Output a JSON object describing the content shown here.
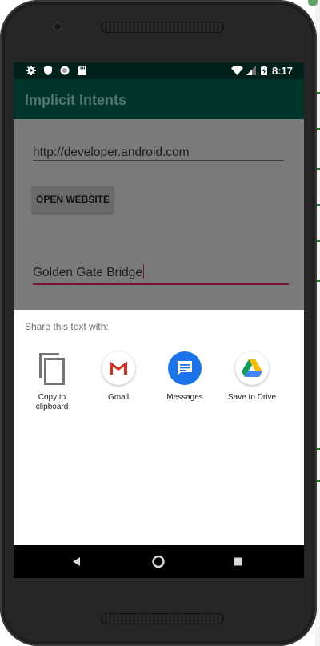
{
  "status_bar": {
    "time": "8:17",
    "left_icons": [
      "gear-icon",
      "shield-icon",
      "circle-icon",
      "sd-card-icon"
    ],
    "right_icons": [
      "wifi-icon",
      "signal-icon",
      "battery-icon"
    ]
  },
  "app_bar": {
    "title": "Implicit Intents"
  },
  "form": {
    "url_value": "http://developer.android.com",
    "open_website_label": "OPEN WEBSITE",
    "location_value": "Golden Gate Bridge"
  },
  "share_sheet": {
    "title": "Share this text with:",
    "targets": [
      {
        "label_line1": "Copy to",
        "label_line2": "clipboard",
        "icon": "copy-icon"
      },
      {
        "label_line1": "Gmail",
        "label_line2": "",
        "icon": "gmail-icon"
      },
      {
        "label_line1": "Messages",
        "label_line2": "",
        "icon": "messages-icon"
      },
      {
        "label_line1": "Save to Drive",
        "label_line2": "",
        "icon": "drive-icon"
      }
    ]
  },
  "nav_bar": {
    "icons": [
      "back-icon",
      "home-icon",
      "recents-icon"
    ]
  },
  "colors": {
    "status_bar": "#00201a",
    "app_bar": "#00352c",
    "accent_line": "#7a1436",
    "messages_blue": "#1a73e8"
  }
}
